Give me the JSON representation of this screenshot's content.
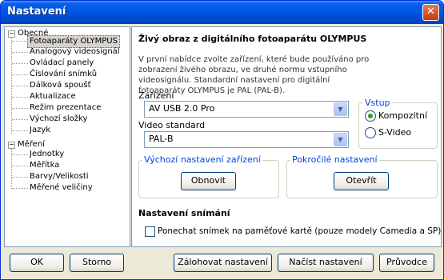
{
  "window": {
    "title": "Nastavení"
  },
  "tree": {
    "groups": [
      {
        "label": "Obecné",
        "items": [
          "Fotoaparáty OLYMPUS",
          "Analogový videosignál",
          "Ovládací panely",
          "Číslování snímků",
          "Dálková spoušť",
          "Aktualizace",
          "Režim prezentace",
          "Výchozí složky",
          "Jazyk"
        ]
      },
      {
        "label": "Měření",
        "items": [
          "Jednotky",
          "Měřítka",
          "Barvy/Velikosti",
          "Měřené veličiny"
        ]
      }
    ],
    "selected": "Fotoaparáty OLYMPUS"
  },
  "panel": {
    "heading": "Živý obraz z digitálního fotoaparátu OLYMPUS",
    "description": "V první nabídce zvolte zařízení, které bude používáno pro zobrazení živého obrazu, ve druhé normu vstupního videosignálu. Standardní nastavení pro digitální fotoaparáty OLYMPUS je PAL (PAL-B).",
    "device_label": "Zařízení",
    "device_value": "AV USB 2.0 Pro",
    "video_label": "Video standard",
    "video_value": "PAL-B",
    "input_group": "Vstup",
    "input_options": [
      "Kompozitní",
      "S-Video"
    ],
    "input_selected": "Kompozitní",
    "default_group": "Výchozí nastavení zařízení",
    "default_button": "Obnovit",
    "advanced_group": "Pokročilé nastavení",
    "advanced_button": "Otevřít",
    "capture_heading": "Nastavení snímání",
    "capture_checkbox": "Ponechat snímek na paměťové kartě (pouze modely Camedia a SP)"
  },
  "footer": {
    "ok": "OK",
    "cancel": "Storno",
    "backup": "Zálohovat nastavení",
    "load": "Načíst nastavení",
    "wizard": "Průvodce"
  }
}
